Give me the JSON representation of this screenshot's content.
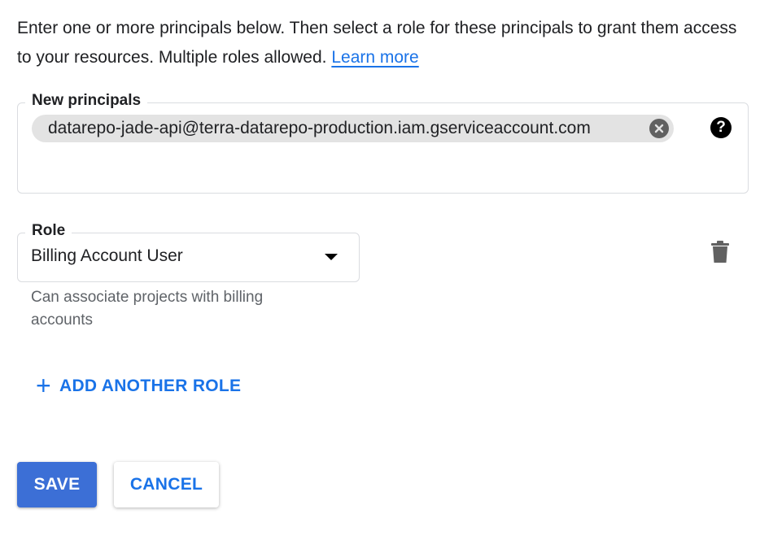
{
  "intro": {
    "text": "Enter one or more principals below. Then select a role for these principals to grant them access to your resources. Multiple roles allowed. ",
    "link_label": "Learn more"
  },
  "principals": {
    "label": "New principals",
    "chips": [
      {
        "value": "datarepo-jade-api@terra-datarepo-production.iam.gserviceaccount.com"
      }
    ],
    "help_icon": "help-circle-icon"
  },
  "role": {
    "label": "Role",
    "selected": "Billing Account User",
    "description": "Can associate projects with billing accounts",
    "delete_icon": "trash-icon"
  },
  "add_role": {
    "label": "ADD ANOTHER ROLE",
    "icon": "plus-icon"
  },
  "actions": {
    "save_label": "SAVE",
    "cancel_label": "CANCEL"
  },
  "colors": {
    "accent": "#1a73e8",
    "primary_button": "#3c6fd6",
    "chip_bg": "#e3e3e3"
  }
}
